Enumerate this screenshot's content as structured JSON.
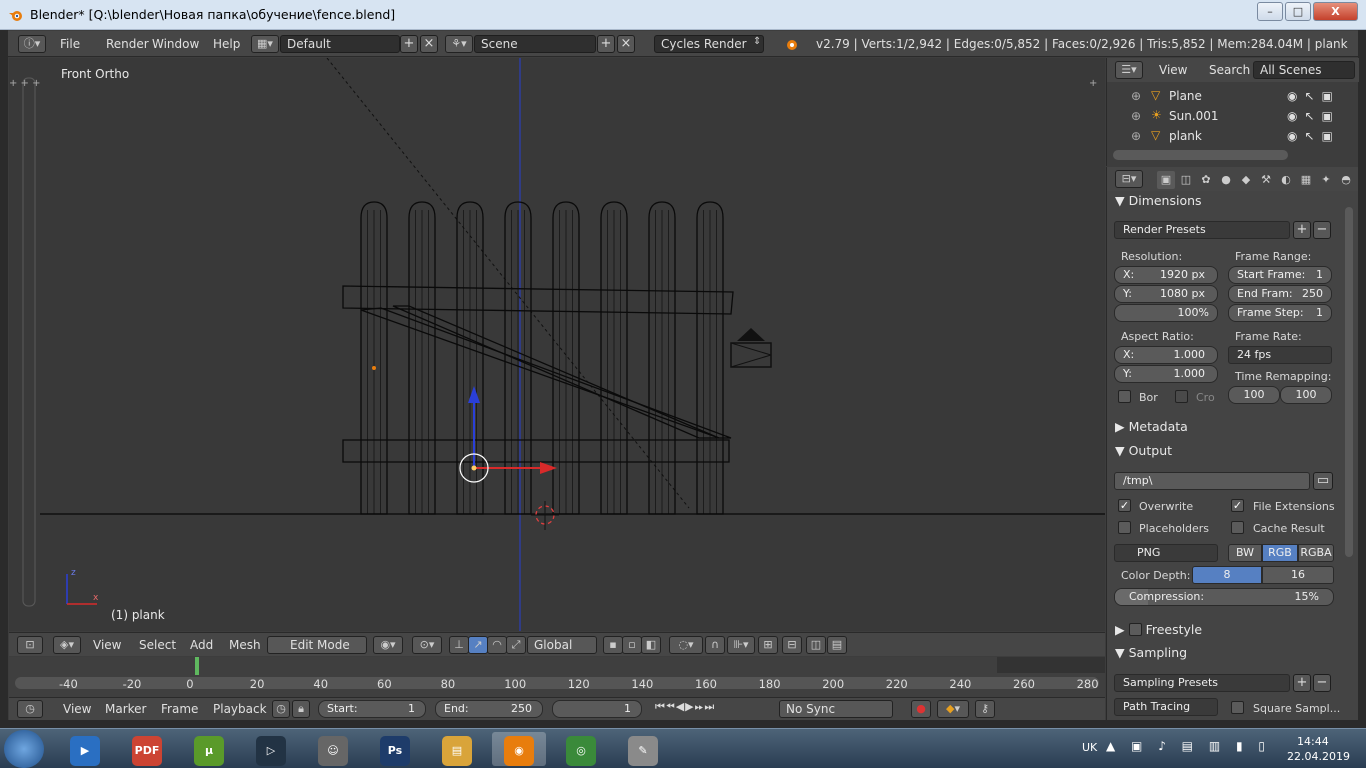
{
  "window": {
    "title": "Blender* [Q:\\blender\\Новая папка\\обучение\\fence.blend]",
    "minimize": "–",
    "maximize": "□",
    "close": "X"
  },
  "topbar": {
    "menu": [
      "File",
      "Render",
      "Window",
      "Help"
    ],
    "layout": "Default",
    "scene": "Scene",
    "engine": "Cycles Render",
    "stats": "v2.79 | Verts:1/2,942 | Edges:0/5,852 | Faces:0/2,926 | Tris:5,852 | Mem:284.04M | plank"
  },
  "viewport": {
    "view_name": "Front Ortho",
    "object_name": "(1) plank",
    "axis_x": "x",
    "axis_z": "z"
  },
  "vp_header": {
    "view": "View",
    "select": "Select",
    "add": "Add",
    "mesh": "Mesh",
    "mode": "Edit Mode",
    "orientation": "Global"
  },
  "timeline": {
    "ticks": [
      "-40",
      "-20",
      "0",
      "20",
      "40",
      "60",
      "80",
      "100",
      "120",
      "140",
      "160",
      "180",
      "200",
      "220",
      "240",
      "260",
      "280"
    ]
  },
  "tl_header": {
    "view": "View",
    "marker": "Marker",
    "frame": "Frame",
    "playback": "Playback",
    "start_label": "Start:",
    "start": "1",
    "end_label": "End:",
    "end": "250",
    "current": "1",
    "sync": "No Sync"
  },
  "outliner": {
    "view": "View",
    "search": "Search",
    "filter": "All Scenes",
    "items": [
      "Plane",
      "Sun.001",
      "plank"
    ]
  },
  "props": {
    "dimensions": "Dimensions",
    "render_presets": "Render Presets",
    "resolution": "Resolution:",
    "res_x_label": "X:",
    "res_x": "1920 px",
    "res_y_label": "Y:",
    "res_y": "1080 px",
    "res_pct": "100%",
    "frame_range": "Frame Range:",
    "start_frame": "Start Frame:",
    "start_frame_val": "1",
    "end_frame": "End Fram:",
    "end_frame_val": "250",
    "frame_step": "Frame Step:",
    "frame_step_val": "1",
    "aspect": "Aspect Ratio:",
    "asp_x": "1.000",
    "asp_y": "1.000",
    "frame_rate": "Frame Rate:",
    "fps": "24 fps",
    "time_remap": "Time Remapping:",
    "remap_old": "100",
    "remap_new": "100",
    "border": "Bor",
    "crop": "Cro",
    "metadata": "Metadata",
    "output": "Output",
    "path": "/tmp\\",
    "overwrite": "Overwrite",
    "file_ext": "File Extensions",
    "placeholders": "Placeholders",
    "cache": "Cache Result",
    "format": "PNG",
    "bw": "BW",
    "rgb": "RGB",
    "rgba": "RGBA",
    "color_depth": "Color Depth:",
    "depth8": "8",
    "depth16": "16",
    "compression": "Compression:",
    "compression_val": "15%",
    "freestyle": "Freestyle",
    "sampling": "Sampling",
    "sampling_presets": "Sampling Presets",
    "path_tracing": "Path Tracing",
    "square": "Square Sampl..."
  },
  "tray": {
    "lang": "UK",
    "time": "14:44",
    "date": "22.04.2019"
  },
  "taskbar_apps": [
    "media",
    "pdf",
    "torrent",
    "video",
    "gimp",
    "photoshop",
    "folder",
    "blender",
    "chrome",
    "paint"
  ],
  "colors": {
    "accent_blue": "#5680c2",
    "bg_viewport": "#393939",
    "blender_orange": "#e87d0d"
  }
}
